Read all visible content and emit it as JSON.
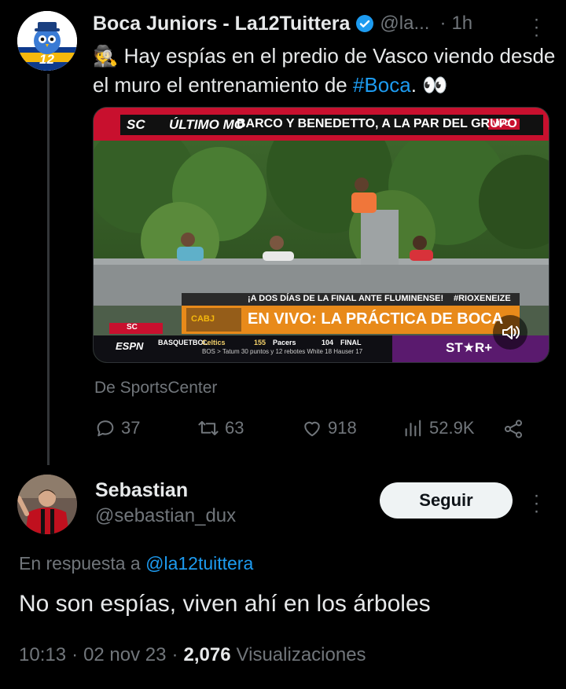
{
  "tweet": {
    "author_name": "Boca Juniors - La12Tuittera",
    "handle": "@la...",
    "time_sep": "·",
    "time": "1h",
    "emoji_detective": "🕵",
    "text_part1": "Hay espías en el predio de Vasco viendo desde el muro el entrenamiento de ",
    "hashtag": "#Boca",
    "text_part2": ". 👀",
    "avatar_number": "12",
    "media": {
      "ticker_brand": "SC",
      "ticker_label": "ÚLTIMO MO",
      "ticker_headline": "BARCO Y BENEDETTO, A LA PAR DEL GRUPO",
      "live_badge": "VIVO",
      "subtitle": "¡A DOS DÍAS DE LA FINAL ANTE FLUMINENSE!",
      "hashtag_banner": "#RIOXENEIZE",
      "main_banner": "EN VIVO: LA PRÁCTICA DE BOCA",
      "club1_badge": "CABJ",
      "channel_logo": "ESPN",
      "score_category": "BASQUETBOL",
      "team1": "Celtics",
      "score1": "155",
      "team2": "Pacers",
      "score2": "104",
      "status": "FINAL",
      "score_detail": "BOS > Tatum 30 puntos y 12 rebotes   White 18   Hauser 17",
      "streaming_logo": "ST★R+",
      "sc_small": "SC"
    },
    "source": "De SportsCenter",
    "replies": "37",
    "retweets": "63",
    "likes": "918",
    "views": "52.9K"
  },
  "reply": {
    "author_name": "Sebastian",
    "handle": "@sebastian_dux",
    "follow_label": "Seguir",
    "in_reply_prefix": "En respuesta a ",
    "in_reply_handle": "@la12tuittera",
    "text": "No son espías, viven ahí en los árboles",
    "time": "10:13",
    "sep1": "·",
    "date": "02 nov 23",
    "sep2": "·",
    "views_count": "2,076",
    "views_label": "Visualizaciones"
  },
  "colors": {
    "accent": "#1d9bf0",
    "muted": "#71767b",
    "verified": "#1d9bf0",
    "espn_red": "#d81e1e",
    "boca_blue": "#0e3a8c",
    "boca_gold": "#f5b80c"
  }
}
